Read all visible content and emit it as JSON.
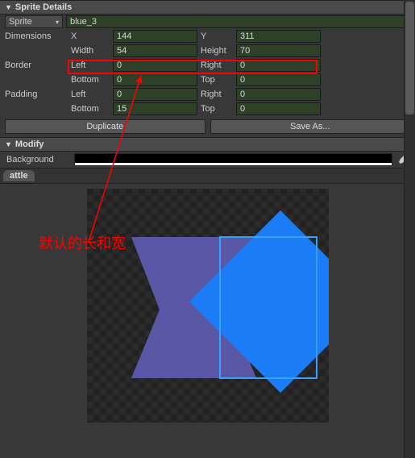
{
  "spriteDetails": {
    "header": "Sprite Details",
    "spriteLabel": "Sprite",
    "spriteDropdown": "Sprite",
    "spriteName": "blue_3",
    "dimensionsLabel": "Dimensions",
    "xLabel": "X",
    "xValue": "144",
    "yLabel": "Y",
    "yValue": "311",
    "widthLabel": "Width",
    "widthValue": "54",
    "heightLabel": "Height",
    "heightValue": "70",
    "borderLabel": "Border",
    "paddingLabel": "Padding",
    "leftLabel": "Left",
    "rightLabel": "Right",
    "bottomLabel": "Bottom",
    "topLabel": "Top",
    "border": {
      "left": "0",
      "right": "0",
      "bottom": "0",
      "top": "0"
    },
    "padding": {
      "left": "0",
      "right": "0",
      "bottom": "15",
      "top": "0"
    },
    "duplicateLabel": "Duplicate",
    "saveAsLabel": "Save As..."
  },
  "modify": {
    "header": "Modify",
    "backgroundLabel": "Background"
  },
  "tab": {
    "label": "attle"
  },
  "annotation": {
    "text": "默认的长和宽"
  }
}
